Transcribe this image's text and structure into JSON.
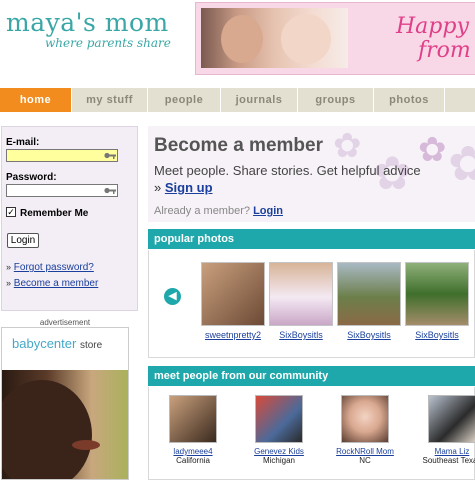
{
  "header": {
    "logo_title": "maya's mom",
    "logo_tagline": "where parents share",
    "banner_line1": "Happy",
    "banner_line2": "from"
  },
  "nav": {
    "tabs": [
      {
        "label": "home",
        "active": true
      },
      {
        "label": "my stuff"
      },
      {
        "label": "people"
      },
      {
        "label": "journals"
      },
      {
        "label": "groups"
      },
      {
        "label": "photos"
      }
    ]
  },
  "login": {
    "email_label": "E-mail:",
    "email_value": "",
    "password_label": "Password:",
    "password_value": "",
    "remember_label": "Remember Me",
    "remember_checked": true,
    "button_label": "Login",
    "forgot_link": "Forgot password?",
    "become_link": "Become a member"
  },
  "ad": {
    "label": "advertisement",
    "brand": "babycenter",
    "brand_suffix": "store"
  },
  "become": {
    "title": "Become a member",
    "description": "Meet people. Share stories. Get helpful advice",
    "signup_link": "Sign up",
    "already_text": "Already a member?",
    "login_link": "Login"
  },
  "popular_photos": {
    "heading": "popular photos",
    "items": [
      {
        "caption": "sweetnpretty2"
      },
      {
        "caption": "SixBoysitls"
      },
      {
        "caption": "SixBoysitls"
      },
      {
        "caption": "SixBoysitls"
      }
    ]
  },
  "community": {
    "heading": "meet people from our community",
    "members": [
      {
        "name": "ladymeee4",
        "location": "California"
      },
      {
        "name": "Genevez Kids",
        "location": "Michigan"
      },
      {
        "name": "RockNRoll Mom",
        "location": "NC"
      },
      {
        "name": "Mama Liz",
        "location": "Southeast Texas"
      }
    ]
  },
  "colors": {
    "brand_teal": "#1fa8ab",
    "nav_active": "#f28c1f",
    "link_blue": "#1a3f9c"
  }
}
